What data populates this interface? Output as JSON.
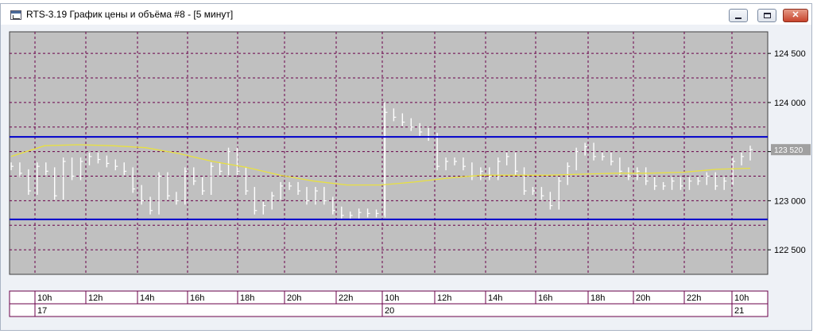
{
  "window": {
    "title": "RTS-3.19 График цены и объёма #8 - [5 минут]",
    "controls": {
      "minimize": "minimize",
      "restore": "restore",
      "close": "✕"
    }
  },
  "colors": {
    "plot_bg": "#c0c0c0",
    "grid": "#6a004a",
    "bars": "#ffffff",
    "channel_lines": "#0000cc",
    "moving_average": "#e8e040",
    "price_flag_bg": "#a0a0a0"
  },
  "chart_data": {
    "type": "ohlc",
    "interval": "5 минут",
    "y_axis": {
      "ylim": [
        122250,
        124720
      ],
      "ticks": [
        122500,
        123000,
        123500,
        124000,
        124500
      ],
      "tick_labels": [
        "122 500",
        "123 000",
        "123 500",
        "124 000",
        "124 500"
      ],
      "position": "right"
    },
    "x_axis": {
      "time_labels": [
        "10h",
        "12h",
        "14h",
        "16h",
        "18h",
        "20h",
        "22h",
        "10h",
        "12h",
        "14h",
        "16h",
        "18h",
        "20h",
        "22h",
        "10h"
      ],
      "date_labels": [
        "17",
        "20",
        "21"
      ]
    },
    "last_price": 123520,
    "last_price_label": "123 520",
    "horizontal_lines": [
      123650,
      122810
    ],
    "moving_average": {
      "values": [
        123450,
        123560,
        123570,
        123560,
        123540,
        123480,
        123400,
        123340,
        123260,
        123200,
        123160,
        123160,
        123190,
        123230,
        123260,
        123260,
        123260,
        123270,
        123280,
        123280,
        123290,
        123320,
        123330
      ]
    },
    "series": {
      "values": [
        123350,
        123280,
        123100,
        123350,
        123300,
        123050,
        123400,
        123250,
        123400,
        123450,
        123420,
        123380,
        123350,
        123300,
        123120,
        123000,
        122900,
        123250,
        123050,
        123000,
        123300,
        123200,
        123100,
        123350,
        123300,
        123500,
        123300,
        123100,
        122900,
        122950,
        123050,
        123150,
        123150,
        123100,
        123000,
        123100,
        123000,
        122900,
        122850,
        122850,
        122880,
        122870,
        122870,
        123900,
        123850,
        123800,
        123750,
        123700,
        123650,
        123350,
        123400,
        123400,
        123350,
        123250,
        123300,
        123250,
        123400,
        123450,
        123300,
        123100,
        123100,
        123050,
        122950,
        123200,
        123350,
        123500,
        123550,
        123450,
        123450,
        123400,
        123300,
        123250,
        123300,
        123200,
        123150,
        123150,
        123200,
        123150,
        123200,
        123200,
        123250,
        123150,
        123200,
        123400,
        123450,
        123520
      ]
    }
  }
}
